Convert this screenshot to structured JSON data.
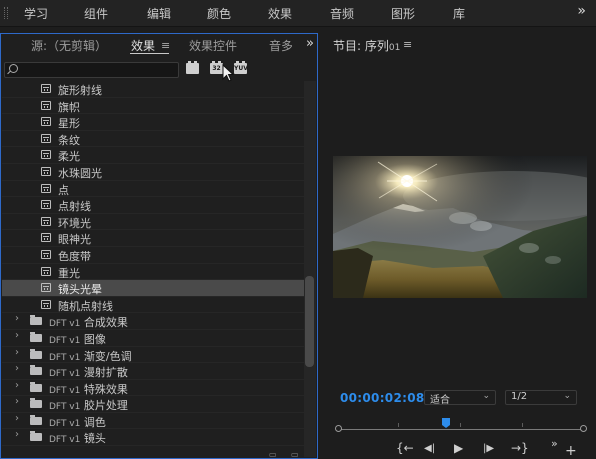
{
  "workspace": {
    "tabs": [
      "学习",
      "组件",
      "编辑",
      "颜色",
      "效果",
      "音频",
      "图形",
      "库"
    ],
    "more": "»"
  },
  "left_panel": {
    "tabs": {
      "source": "源:（无剪辑）",
      "effects": "效果",
      "effect_controls": "效果控件",
      "audio_clipped": "音多"
    },
    "menu_glyph": "≡",
    "more": "»",
    "search": {
      "value": "",
      "placeholder": ""
    },
    "filter_buttons": [
      {
        "icon": "accelerated-effects-icon",
        "label": ""
      },
      {
        "icon": "32bit-effects-icon",
        "label": "32"
      },
      {
        "icon": "yuv-effects-icon",
        "label": "YUV"
      }
    ],
    "effects": [
      "旋形射线",
      "旗帜",
      "星形",
      "条纹",
      "柔光",
      "水珠圆光",
      "点",
      "点射线",
      "环境光",
      "眼神光",
      "色度带",
      "重光",
      "镜头光晕",
      "随机点射线"
    ],
    "selected_effect": "镜头光晕",
    "folders": [
      {
        "prefix": "DFT v1",
        "name": "合成效果"
      },
      {
        "prefix": "DFT v1",
        "name": "图像"
      },
      {
        "prefix": "DFT v1",
        "name": "渐变/色调"
      },
      {
        "prefix": "DFT v1",
        "name": "漫射扩散"
      },
      {
        "prefix": "DFT v1",
        "name": "特殊效果"
      },
      {
        "prefix": "DFT v1",
        "name": "胶片处理"
      },
      {
        "prefix": "DFT v1",
        "name": "调色"
      },
      {
        "prefix": "DFT v1",
        "name": "镜头"
      }
    ]
  },
  "program_monitor": {
    "title": "节目: 序列",
    "title_suffix": "01",
    "menu_glyph": "≡",
    "timecode": "00:00:02:08",
    "fit": {
      "value": "适合"
    },
    "resolution": {
      "value": "1/2"
    },
    "playhead_fraction": 0.44,
    "more": "»",
    "add": "+",
    "transport": {
      "mark_in": "{←",
      "step_back": "◀|",
      "play": "▶",
      "step_forward": "|▶",
      "mark_out": "→}"
    }
  },
  "colors": {
    "accent_blue": "#2d8ceb",
    "panel_border": "#2e69c9",
    "selected_row": "#4a4a4a"
  }
}
